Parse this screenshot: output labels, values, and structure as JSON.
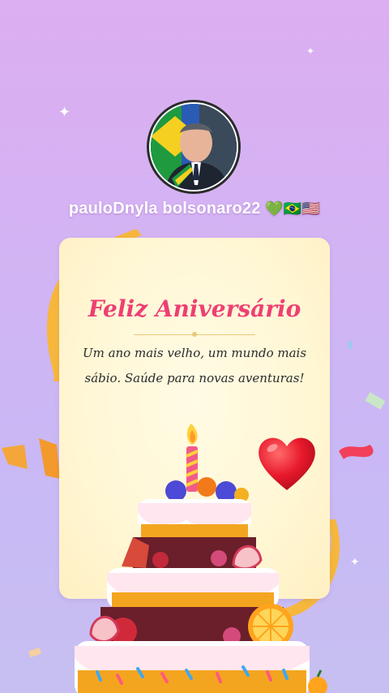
{
  "profile": {
    "username": "pauloDnyla bolsonaro22",
    "emoji": "💚🇧🇷🇺🇸"
  },
  "card": {
    "title": "Feliz Aniversário",
    "message_line1": "Um ano mais velho, um mundo mais",
    "message_line2": "sábio. Saúde para novas aventuras!"
  },
  "icons": [
    "avatar-photo",
    "heart-icon",
    "birthday-cake-icon",
    "candle-icon",
    "confetti-ribbon",
    "sparkle-icon"
  ],
  "colors": {
    "title": "#ee3f73",
    "heart": "#e8192c",
    "card_bg": "#fff7d6",
    "ribbon": "#f6b73c"
  }
}
